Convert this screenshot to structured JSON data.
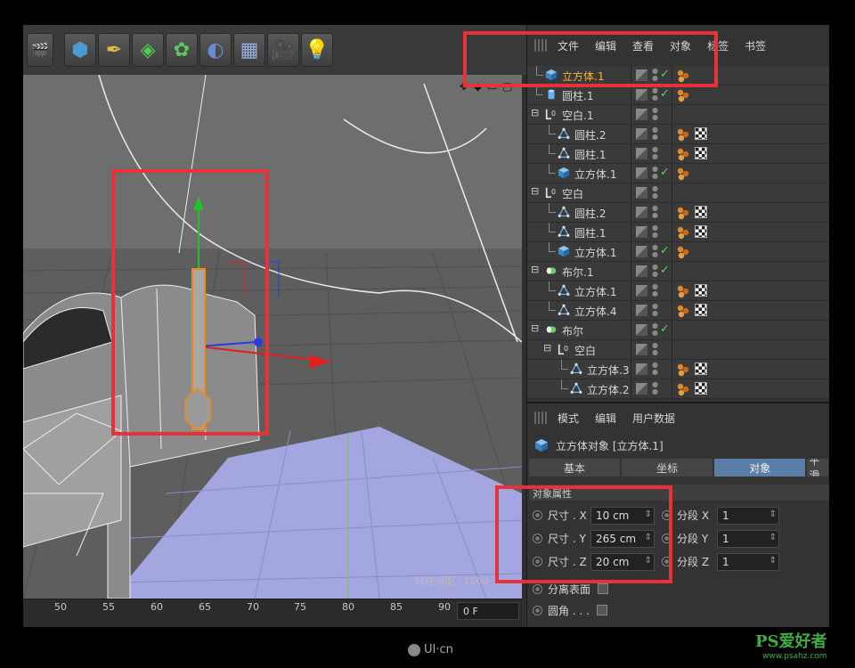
{
  "object_manager": {
    "menu": [
      "文件",
      "编辑",
      "查看",
      "对象",
      "标签",
      "书签"
    ],
    "items": [
      {
        "name": "立方体.1",
        "indent": 0,
        "icon": "cube-icon",
        "selected": true,
        "check": true,
        "tags": [
          "material"
        ]
      },
      {
        "name": "圆柱.1",
        "indent": 0,
        "icon": "cylinder-icon",
        "check": true,
        "tags": [
          "material"
        ]
      },
      {
        "name": "空白.1",
        "indent": 0,
        "icon": "null-icon",
        "expand": true,
        "tags": []
      },
      {
        "name": "圆柱.2",
        "indent": 1,
        "icon": "polygon-icon",
        "tags": [
          "material",
          "texture"
        ]
      },
      {
        "name": "圆柱.1",
        "indent": 1,
        "icon": "polygon-icon",
        "tags": [
          "material",
          "texture"
        ]
      },
      {
        "name": "立方体.1",
        "indent": 1,
        "icon": "cube-icon",
        "check": true,
        "tags": [
          "material"
        ]
      },
      {
        "name": "空白",
        "indent": 0,
        "icon": "null-icon",
        "expand": true,
        "tags": []
      },
      {
        "name": "圆柱.2",
        "indent": 1,
        "icon": "polygon-icon",
        "tags": [
          "material",
          "texture"
        ]
      },
      {
        "name": "圆柱.1",
        "indent": 1,
        "icon": "polygon-icon",
        "tags": [
          "material",
          "texture"
        ]
      },
      {
        "name": "立方体.1",
        "indent": 1,
        "icon": "cube-icon",
        "check": true,
        "tags": [
          "material"
        ]
      },
      {
        "name": "布尔.1",
        "indent": 0,
        "icon": "boole-icon",
        "expand": true,
        "check": true,
        "tags": []
      },
      {
        "name": "立方体.1",
        "indent": 1,
        "icon": "polygon-icon",
        "tags": [
          "material",
          "texture"
        ]
      },
      {
        "name": "立方体.4",
        "indent": 1,
        "icon": "polygon-icon",
        "tags": [
          "material",
          "texture"
        ]
      },
      {
        "name": "布尔",
        "indent": 0,
        "icon": "boole-icon",
        "expand": true,
        "check": true,
        "tags": []
      },
      {
        "name": "空白",
        "indent": 1,
        "icon": "null-icon",
        "expand": true,
        "tags": []
      },
      {
        "name": "立方体.3",
        "indent": 2,
        "icon": "polygon-icon",
        "tags": [
          "material",
          "texture"
        ]
      },
      {
        "name": "立方体.2",
        "indent": 2,
        "icon": "polygon-icon",
        "tags": [
          "material",
          "texture"
        ]
      }
    ]
  },
  "attributes": {
    "menu": [
      "模式",
      "编辑",
      "用户数据"
    ],
    "title": "立方体对象 [立方体.1]",
    "tabs": [
      {
        "label": "基本",
        "active": false
      },
      {
        "label": "坐标",
        "active": false
      },
      {
        "label": "对象",
        "active": true
      },
      {
        "label": "平滑",
        "active": false
      }
    ],
    "section": "对象属性",
    "size": [
      {
        "label": "尺寸 . X",
        "value": "10 cm"
      },
      {
        "label": "尺寸 . Y",
        "value": "265 cm"
      },
      {
        "label": "尺寸 . Z",
        "value": "20 cm"
      }
    ],
    "segments": [
      {
        "label": "分段 X",
        "value": "1"
      },
      {
        "label": "分段 Y",
        "value": "1"
      },
      {
        "label": "分段 Z",
        "value": "1"
      }
    ],
    "separate_surfaces": "分离表面",
    "fillet": "圆角 . . ."
  },
  "viewport": {
    "grid_spacing_label": "网格间距 : 1000",
    "nav_icons": "✥ ◆ ▭ ▢"
  },
  "timeline": {
    "ticks": [
      "50",
      "55",
      "60",
      "65",
      "70",
      "75",
      "80",
      "85",
      "90"
    ],
    "frame": "0 F"
  },
  "watermarks": {
    "center": "UI·cn",
    "right_brand": "PS爱好者",
    "right_url": "www.psahz.com"
  },
  "colors": {
    "highlight": "#e8323a",
    "selected_text": "#ffb62a",
    "active_tab": "#5a7ea8"
  }
}
